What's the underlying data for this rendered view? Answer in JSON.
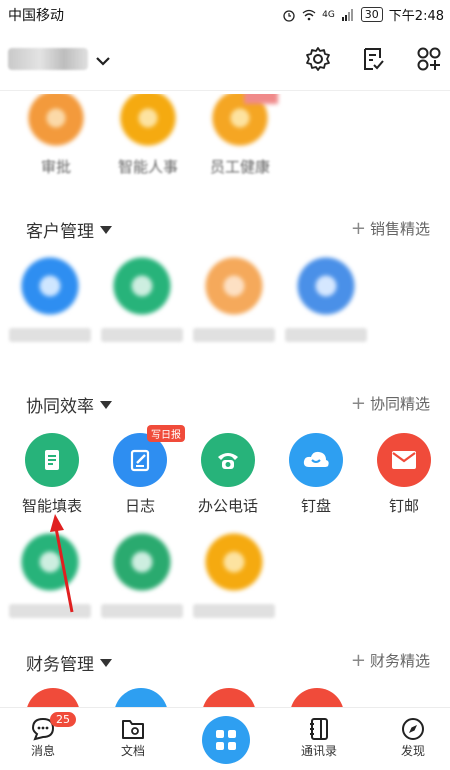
{
  "status_bar": {
    "carrier": "中国移动",
    "signal_label": "4G",
    "battery": "30",
    "time": "下午2:48"
  },
  "header": {
    "org_name": ""
  },
  "top_partial_labels": [
    "审批",
    "智能人事",
    "员工健康"
  ],
  "sections": [
    {
      "title": "客户管理",
      "picks": "销售精选"
    },
    {
      "title": "协同效率",
      "picks": "协同精选"
    },
    {
      "title": "财务管理",
      "picks": "财务精选"
    }
  ],
  "collab_apps": [
    {
      "label": "智能填表",
      "icon": "form-icon",
      "color": "#27b37a"
    },
    {
      "label": "日志",
      "icon": "log-icon",
      "color": "#2e8ef1",
      "badge": "写日报"
    },
    {
      "label": "办公电话",
      "icon": "phone-icon",
      "color": "#27b37a"
    },
    {
      "label": "钉盘",
      "icon": "cloud-icon",
      "color": "#2e9ff1"
    },
    {
      "label": "钉邮",
      "icon": "mail-icon",
      "color": "#f04b3a"
    }
  ],
  "bottom_nav": {
    "messages": "消息",
    "messages_badge": "25",
    "docs": "文档",
    "contacts": "通讯录",
    "discover": "发现"
  },
  "colors": {
    "accent": "#2e9ff1",
    "red": "#f04b3a",
    "green": "#27b37a",
    "orange": "#f5a623"
  }
}
